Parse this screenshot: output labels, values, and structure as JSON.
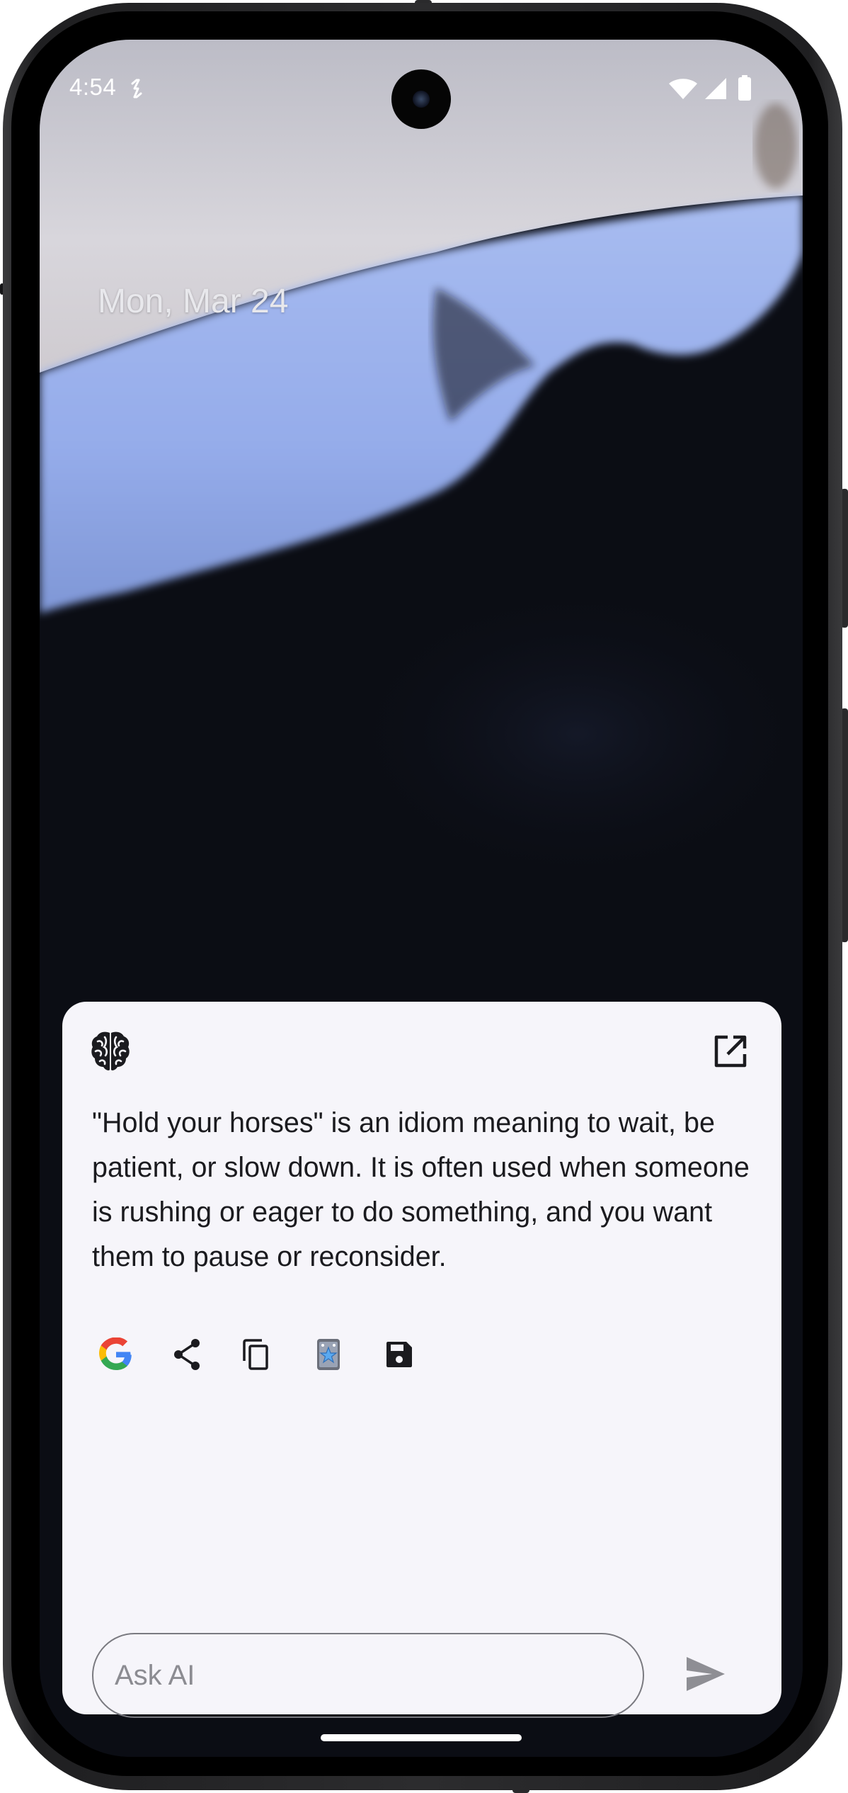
{
  "status_bar": {
    "time": "4:54",
    "icons": [
      "sync-icon",
      "wifi-icon",
      "cellular-signal-icon",
      "battery-icon"
    ]
  },
  "lock_screen": {
    "date": "Mon, Mar 24"
  },
  "ai_card": {
    "header_icon": "brain-icon",
    "open_icon": "open-in-new-icon",
    "answer": "\"Hold your horses\" is an idiom meaning to wait, be patient, or slow down. It is often used when someone is rushing or eager to do something, and you want them to pause or reconsider.",
    "actions": [
      "google-search-icon",
      "share-icon",
      "copy-icon",
      "app-shortcut-icon",
      "save-icon"
    ],
    "input": {
      "placeholder": "Ask AI",
      "value": ""
    },
    "send_icon": "send-icon"
  },
  "colors": {
    "card_background": "#f6f5fa",
    "wallpaper_dark": "#0b0d14",
    "wallpaper_blue": "#9fb4ec",
    "google_blue": "#4285F4",
    "google_red": "#EA4335",
    "google_yellow": "#FBBC05",
    "google_green": "#34A853"
  }
}
